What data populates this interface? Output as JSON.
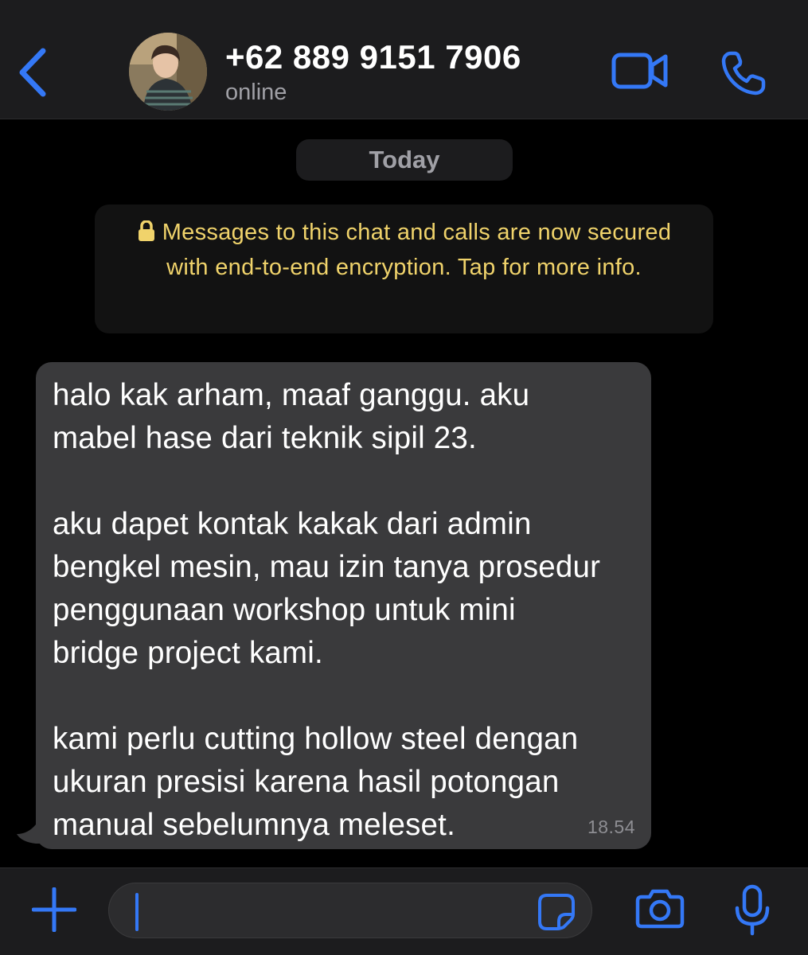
{
  "header": {
    "contact_name": "+62 889 9151 7906",
    "status": "online",
    "back_icon": "chevron-left-icon",
    "video_icon": "video-camera-icon",
    "call_icon": "phone-icon",
    "accent_color": "#3478f6"
  },
  "chat": {
    "day_label": "Today",
    "encryption_notice": "Messages to this chat and calls are now secured with end-to-end encryption. Tap for more info.",
    "notice_color": "#f0d36b",
    "messages": [
      {
        "direction": "incoming",
        "text": "halo kak arham, maaf ganggu. aku\nmabel hase dari teknik sipil 23.\n\naku dapet kontak kakak dari admin\nbengkel mesin, mau izin tanya prosedur\npenggunaan workshop untuk mini\nbridge project kami.\n\nkami perlu cutting hollow steel dengan\nukuran presisi karena hasil potongan\nmanual sebelumnya meleset.",
        "time": "18.54"
      }
    ]
  },
  "input_bar": {
    "plus_icon": "plus-icon",
    "sticker_icon": "sticker-icon",
    "camera_icon": "camera-icon",
    "mic_icon": "microphone-icon"
  }
}
